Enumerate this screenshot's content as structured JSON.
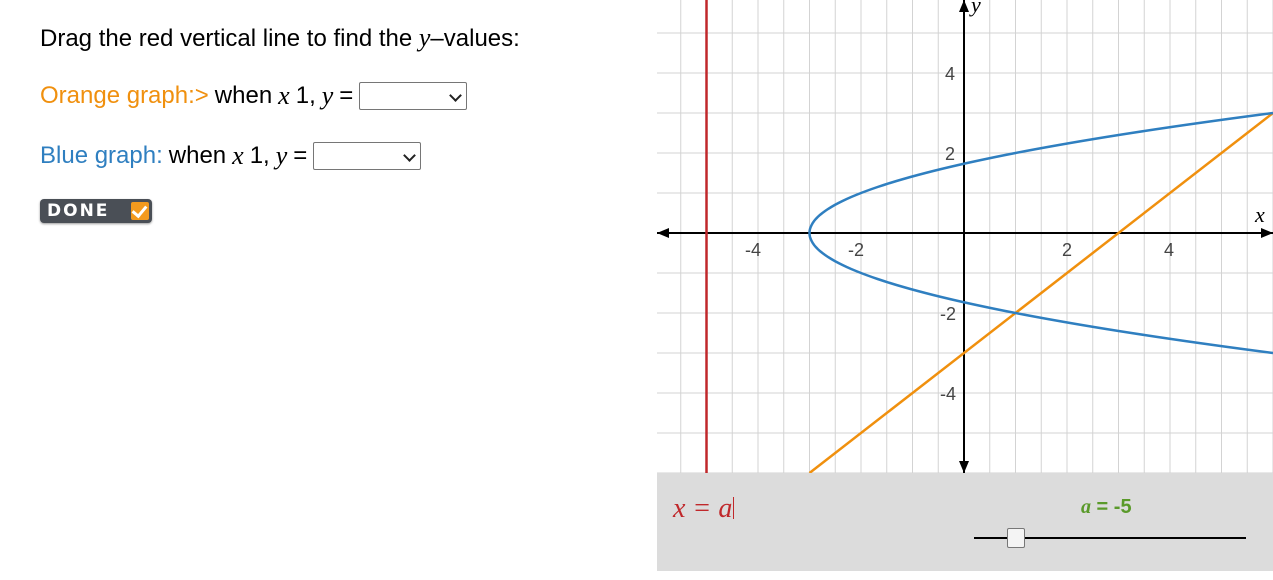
{
  "instruction": {
    "pre": "Drag the red vertical line to find the ",
    "var": "y",
    "post": "–values:"
  },
  "questions": [
    {
      "label": "Orange graph:>",
      "when": "when",
      "xvar": "x",
      "xval": "1,",
      "yvar": "y",
      "eq": "=",
      "selected": ""
    },
    {
      "label": "Blue graph:",
      "when": "when",
      "xvar": "x",
      "xval": "1,",
      "yvar": "y",
      "eq": "=",
      "selected": ""
    }
  ],
  "done_button": {
    "label": "DONE"
  },
  "graph": {
    "x_axis_label": "x",
    "y_axis_label": "y",
    "x_ticks": [
      "-4",
      "-2",
      "2",
      "4"
    ],
    "y_ticks": [
      "4",
      "2",
      "-2",
      "-4"
    ],
    "colors": {
      "red_line": "#c0282b",
      "orange": "#f0900e",
      "blue": "#2f7fc0",
      "grid": "#d3d3d3"
    }
  },
  "chart_data": {
    "type": "line",
    "xlim": [
      -6,
      6
    ],
    "ylim": [
      -6,
      6
    ],
    "grid": true,
    "series": [
      {
        "equation": "y = x - 3",
        "color": "#f0900e"
      },
      {
        "equation": "x = y^2 - 3",
        "color": "#2f7fc0"
      },
      {
        "equation": "x = a",
        "color": "#c0282b",
        "a": -5
      }
    ]
  },
  "control": {
    "equation": "x = a",
    "slider_label_var": "a",
    "slider_label_rest": " = -5",
    "slider": {
      "min": -6,
      "max": 6,
      "value": -5
    }
  }
}
